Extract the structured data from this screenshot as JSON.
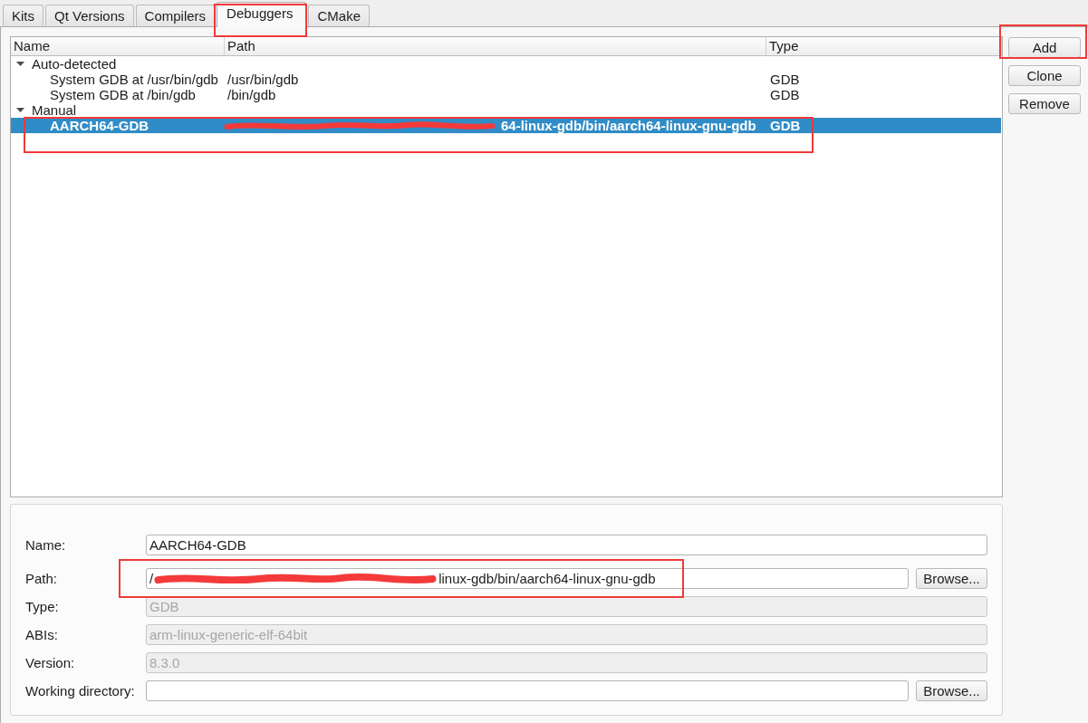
{
  "tabs": [
    {
      "label": "Kits",
      "selected": false,
      "highlighted": false
    },
    {
      "label": "Qt Versions",
      "selected": false,
      "highlighted": false
    },
    {
      "label": "Compilers",
      "selected": false,
      "highlighted": false
    },
    {
      "label": "Debuggers",
      "selected": true,
      "highlighted": true
    },
    {
      "label": "CMake",
      "selected": false,
      "highlighted": false
    }
  ],
  "debugger_tree": {
    "columns": [
      "Name",
      "Path",
      "Type"
    ],
    "groups": [
      {
        "label": "Auto-detected",
        "expanded": true,
        "children": [
          {
            "name": "System GDB at /usr/bin/gdb",
            "path": "/usr/bin/gdb",
            "type": "GDB",
            "selected": false,
            "modified": false,
            "highlighted": false
          },
          {
            "name": "System GDB at /bin/gdb",
            "path": "/bin/gdb",
            "type": "GDB",
            "selected": false,
            "modified": false,
            "highlighted": false
          }
        ]
      },
      {
        "label": "Manual",
        "expanded": true,
        "children": [
          {
            "name": "AARCH64-GDB",
            "path": [
              {
                "kind": "redaction"
              },
              {
                "kind": "text",
                "text": "64-linux-gdb/bin/aarch64-linux-gnu-gdb"
              }
            ],
            "type": "GDB",
            "selected": true,
            "modified": true,
            "highlighted": true
          }
        ]
      }
    ]
  },
  "side_buttons": [
    {
      "label": "Add",
      "highlighted": true
    },
    {
      "label": "Clone",
      "highlighted": false
    },
    {
      "label": "Remove",
      "highlighted": false
    }
  ],
  "details": {
    "fields": [
      {
        "label": "Name:",
        "value": "AARCH64-GDB",
        "disabled": false,
        "highlighted": false
      },
      {
        "label": "Path:",
        "value": [
          {
            "kind": "text",
            "text": "/"
          },
          {
            "kind": "redaction"
          },
          {
            "kind": "text",
            "text": "linux-gdb/bin/aarch64-linux-gnu-gdb"
          }
        ],
        "disabled": false,
        "button": "Browse...",
        "highlighted": true
      },
      {
        "label": "Type:",
        "value": "GDB",
        "disabled": true,
        "highlighted": false
      },
      {
        "label": "ABIs:",
        "value": "arm-linux-generic-elf-64bit",
        "disabled": true,
        "highlighted": false
      },
      {
        "label": "Version:",
        "value": "8.3.0",
        "disabled": true,
        "highlighted": false
      },
      {
        "label": "Working directory:",
        "disabled": false,
        "button": "Browse...",
        "highlighted": false
      }
    ]
  }
}
